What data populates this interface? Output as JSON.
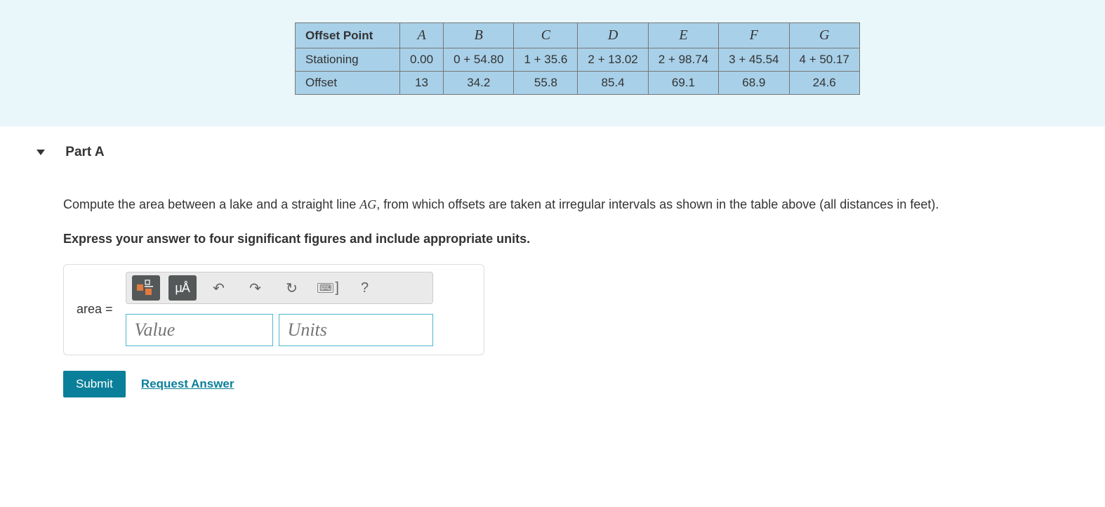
{
  "table": {
    "header_label": "Offset Point",
    "points": [
      "A",
      "B",
      "C",
      "D",
      "E",
      "F",
      "G"
    ],
    "row1_label": "Stationing",
    "stationing": [
      "0.00",
      "0 + 54.80",
      "1 + 35.6",
      "2 + 13.02",
      "2 + 98.74",
      "3 + 45.54",
      "4 + 50.17"
    ],
    "row2_label": "Offset",
    "offset": [
      "13",
      "34.2",
      "55.8",
      "85.4",
      "69.1",
      "68.9",
      "24.6"
    ]
  },
  "part": {
    "label": "Part A"
  },
  "prompt": {
    "pre": "Compute the area between a lake and a straight line ",
    "line": "AG",
    "post": ", from which offsets are taken at irregular intervals as shown in the table above (all distances in feet).",
    "instructions": "Express your answer to four significant figures and include appropriate units."
  },
  "answer": {
    "label": "area =",
    "value_placeholder": "Value",
    "units_placeholder": "Units",
    "tool_special": "μÅ",
    "tool_help": "?"
  },
  "actions": {
    "submit": "Submit",
    "request": "Request Answer"
  }
}
